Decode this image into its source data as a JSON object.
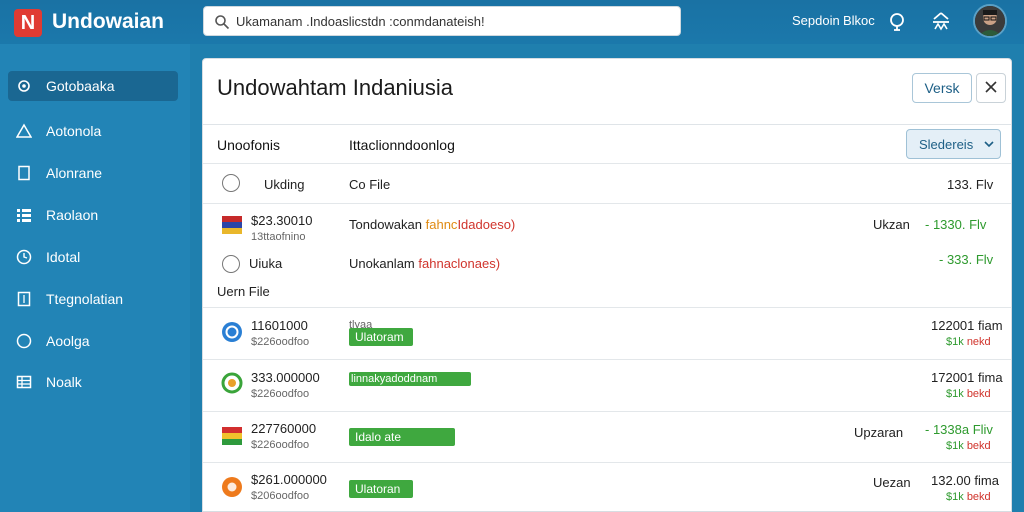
{
  "app": {
    "logo_letter": "N",
    "name": "Undowaian"
  },
  "search": {
    "value": "Ukamanam .Indoaslicstdn :conmdanateish!",
    "placeholder": ""
  },
  "topnav": {
    "link1": "Sepdoin",
    "link2": "Blkoc"
  },
  "sidebar": {
    "items": [
      {
        "label": "Gotobaaka",
        "icon": "gear-icon"
      },
      {
        "label": "Aotonola",
        "icon": "warning-icon"
      },
      {
        "label": "Alonrane",
        "icon": "document-icon"
      },
      {
        "label": "Raolaon",
        "icon": "grid-icon"
      },
      {
        "label": "Idotal",
        "icon": "clock-icon"
      },
      {
        "label": "Ttegnolatian",
        "icon": "building-icon"
      },
      {
        "label": "Aoolga",
        "icon": "circle-icon"
      },
      {
        "label": "Noalk",
        "icon": "table-icon"
      }
    ]
  },
  "panel": {
    "title": "Undowahtam Indaniusia",
    "versk_label": "Versk",
    "col1": "Unoofonis",
    "col2": "Ittaclionndoonlog",
    "select_value": "Sledereis"
  },
  "rows": {
    "r1": {
      "name": "Ukding",
      "desc": "Co File",
      "amount": "133. Flv"
    },
    "r2": {
      "name": "$23.30010",
      "sub": "13ttaofnino",
      "desc_main": "Tondowakan",
      "desc_orange": "fahnc",
      "desc_red": "Idadoeso)",
      "status": "Ukzan",
      "amount": "- 1330. Flv"
    },
    "r3": {
      "name": "Uiuka",
      "desc_main": "Unokanlam",
      "desc_red": "fahnaclonaes)",
      "amount": "- 333. Flv"
    },
    "section": "Uern File",
    "r4": {
      "name": "11601000",
      "sub": "$226oodfoo",
      "tag_top": "tlyaa",
      "badge": "Ulatoram",
      "amount": "122001 fiam",
      "sub_green": "$1k",
      "sub_red": "nekd"
    },
    "r5": {
      "name": "333.000000",
      "sub": "$226oodfoo",
      "badge": "linnakyadoddnam",
      "amount": "172001 fima",
      "sub_green": "$1k",
      "sub_red": "bekd"
    },
    "r6": {
      "name": "227760000",
      "sub": "$226oodfoo",
      "badge": "Idalo ate",
      "status": "Upzaran",
      "amount": "- 1338a Fliv",
      "sub_green": "$1k",
      "sub_red": "bekd"
    },
    "r7": {
      "name": "$261.000000",
      "sub": "$206oodfoo",
      "badge": "Ulatoran",
      "status": "Uezan",
      "amount": "132.00 fima",
      "sub_green": "$1k",
      "sub_red": "bekd"
    }
  }
}
